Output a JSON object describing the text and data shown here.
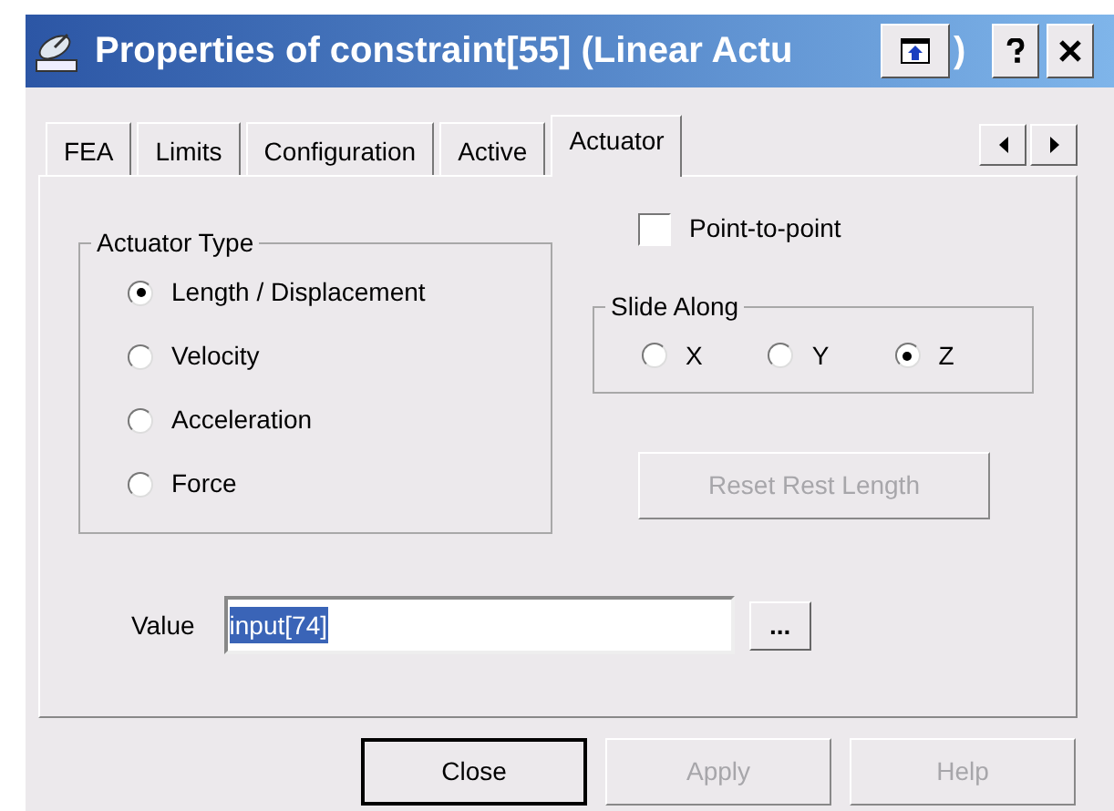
{
  "window": {
    "title": "Properties of constraint[55] (Linear Actu",
    "title_tail": ")"
  },
  "tabs": [
    {
      "label": "FEA",
      "selected": false
    },
    {
      "label": "Limits",
      "selected": false
    },
    {
      "label": "Configuration",
      "selected": false
    },
    {
      "label": "Active",
      "selected": false
    },
    {
      "label": "Actuator",
      "selected": true
    }
  ],
  "actuator_type": {
    "label": "Actuator Type",
    "options": [
      {
        "label": "Length / Displacement",
        "selected": true
      },
      {
        "label": "Velocity",
        "selected": false
      },
      {
        "label": "Acceleration",
        "selected": false
      },
      {
        "label": "Force",
        "selected": false
      }
    ]
  },
  "point_to_point": {
    "label": "Point-to-point",
    "checked": false
  },
  "slide_along": {
    "label": "Slide Along",
    "options": [
      {
        "label": "X",
        "selected": false
      },
      {
        "label": "Y",
        "selected": false
      },
      {
        "label": "Z",
        "selected": true
      }
    ]
  },
  "reset_button": {
    "label": "Reset Rest Length",
    "disabled": true
  },
  "value": {
    "label": "Value",
    "value": "input[74]",
    "text_selected": true,
    "browse_label": "..."
  },
  "buttons": [
    {
      "label": "Close",
      "disabled": false,
      "default": true
    },
    {
      "label": "Apply",
      "disabled": true,
      "default": false
    },
    {
      "label": "Help",
      "disabled": true,
      "default": false
    }
  ]
}
